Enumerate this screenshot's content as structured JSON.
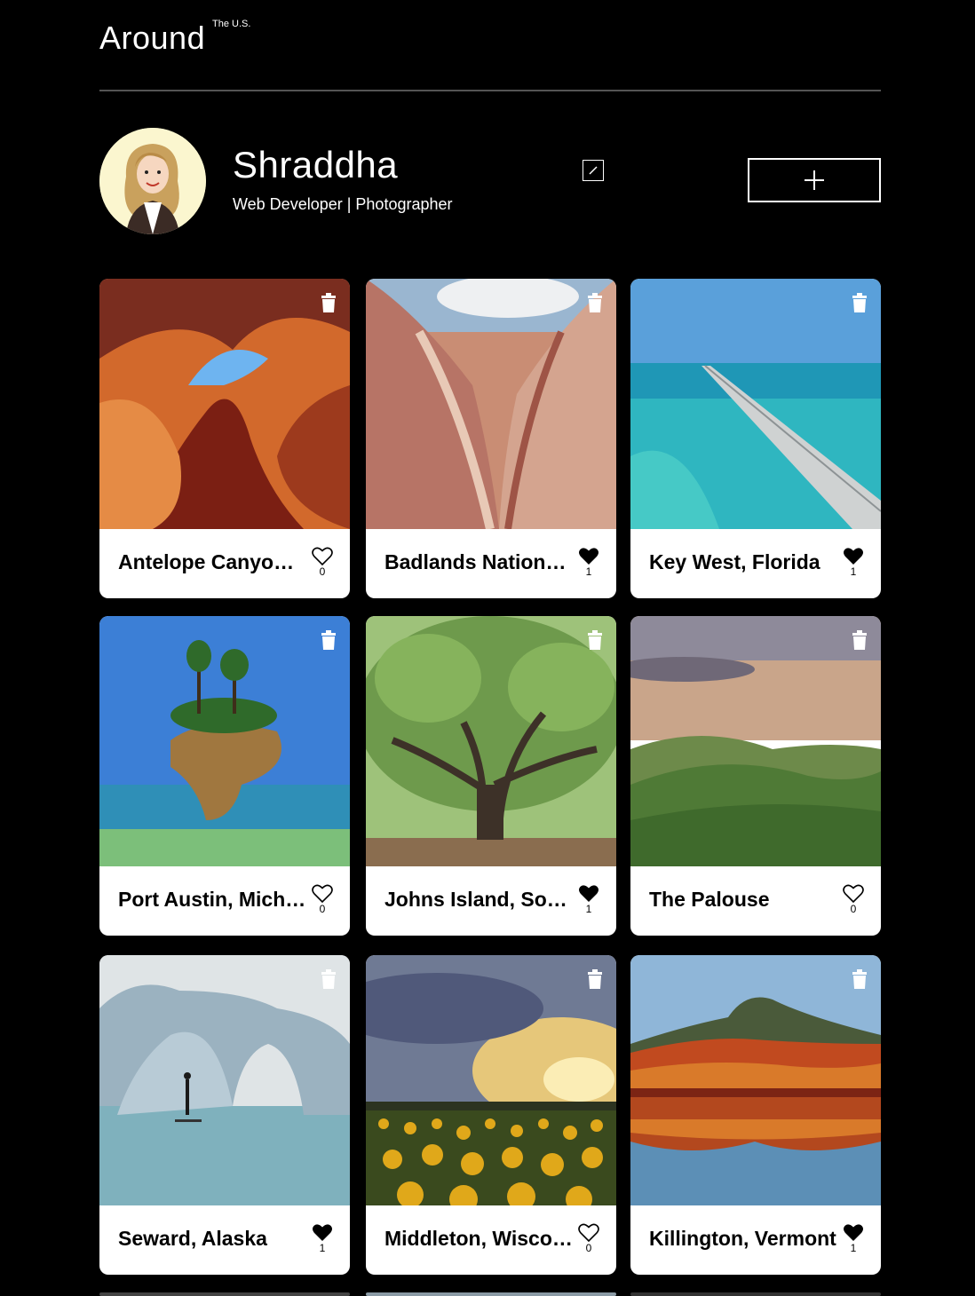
{
  "header": {
    "logo": "Around",
    "logo_sup": "The U.S."
  },
  "profile": {
    "name": "Shraddha",
    "job": "Web Developer | Photographer"
  },
  "cards": [
    {
      "title": "Antelope Canyon, Arizona",
      "likes": "0",
      "liked": false
    },
    {
      "title": "Badlands National Park",
      "likes": "1",
      "liked": true
    },
    {
      "title": "Key West, Florida",
      "likes": "1",
      "liked": true
    },
    {
      "title": "Port Austin, Michigan",
      "likes": "0",
      "liked": false
    },
    {
      "title": "Johns Island, South Carolina",
      "likes": "1",
      "liked": true
    },
    {
      "title": "The Palouse",
      "likes": "0",
      "liked": false
    },
    {
      "title": "Seward, Alaska",
      "likes": "1",
      "liked": true
    },
    {
      "title": "Middleton, Wisconsin",
      "likes": "0",
      "liked": false
    },
    {
      "title": "Killington, Vermont",
      "likes": "1",
      "liked": true
    }
  ]
}
